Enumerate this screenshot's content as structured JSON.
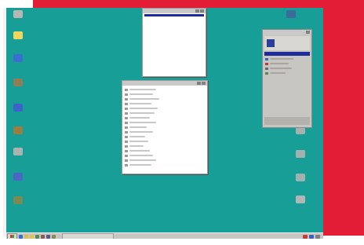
{
  "desktop": {
    "background": "#179f97",
    "left_icons": [
      "recycle-bin-icon",
      "folder-icon",
      "globe-icon",
      "briefcase-icon",
      "network-icon",
      "globe-icon",
      "monitor-icon",
      "inbox-icon",
      "shortcut-icon"
    ],
    "right_icons": [
      "computer-icon",
      "pencil-icon",
      "arrow-icon",
      "arrow-icon",
      "settings-icon"
    ]
  },
  "windows": {
    "top_window_rows": 8,
    "list_window_rows": 17,
    "panel_title": "",
    "panel_rows": 5
  },
  "taskbar": {
    "quick_launch_icons": [
      "browser-icon",
      "mail-icon",
      "folder-icon",
      "app-icon",
      "app-icon",
      "app-icon",
      "app-icon"
    ],
    "tray_icons": [
      "speaker-icon",
      "network-icon",
      "clock-icon"
    ],
    "accent": "#1d2c9a"
  }
}
